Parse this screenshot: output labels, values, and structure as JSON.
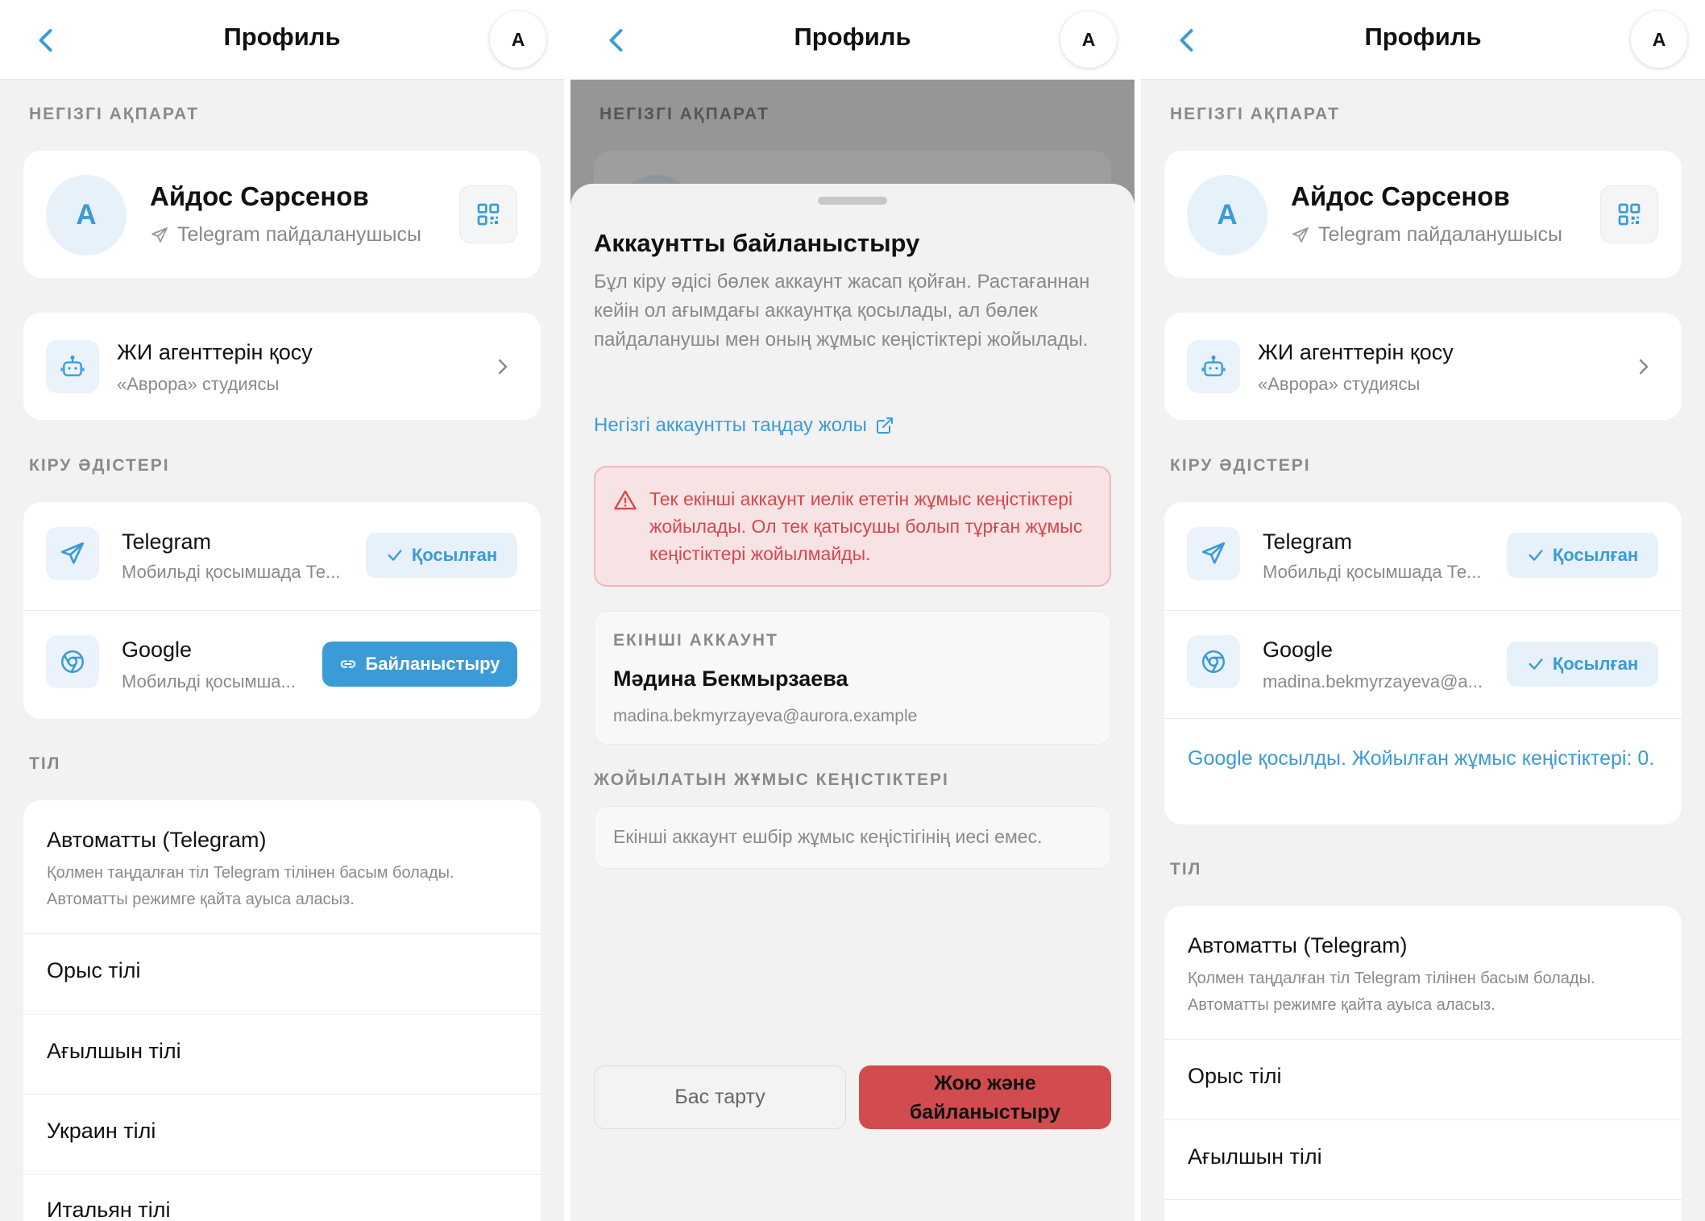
{
  "header": {
    "title": "Профиль",
    "avatar_letter": "A"
  },
  "sections": {
    "basic_info": "НЕГІЗГІ АҚПАРАТ",
    "login_methods": "КІРУ ӘДІСТЕРІ",
    "language": "ТІЛ"
  },
  "profile": {
    "avatar_letter": "A",
    "name": "Айдос Сәрсенов",
    "subtitle": "Telegram пайдаланушысы"
  },
  "ai_agents": {
    "title": "ЖИ агенттерін қосу",
    "subtitle": "«Аврора» студиясы"
  },
  "methods": {
    "telegram": {
      "title": "Telegram",
      "subtitle": "Мобильді қосымшада Те...",
      "status": "Қосылған"
    },
    "google": {
      "title": "Google",
      "subtitle": "Мобильді қосымша...",
      "action": "Байланыстыру"
    },
    "google_after": {
      "subtitle": "madina.bekmyrzayeva@a...",
      "status": "Қосылған"
    },
    "notice": "Google қосылды. Жойылған жұмыс кеңістіктері: 0."
  },
  "languages": {
    "auto_title": "Автоматты (Telegram)",
    "auto_desc": "Қолмен таңдалған тіл Telegram тілінен басым болады. Автоматты режимге қайта ауыса аласыз.",
    "items": [
      "Орыс тілі",
      "Ағылшын тілі",
      "Украин тілі",
      "Итальян тілі"
    ]
  },
  "sheet": {
    "title": "Аккаунтты байланыстыру",
    "description": "Бұл кіру әдісі бөлек аккаунт жасап қойған. Растағаннан кейін ол ағымдағы аккаунтқа қосылады, ал бөлек пайдаланушы мен оның жұмыс кеңістіктері жойылады.",
    "link": "Негізгі аккаунтты таңдау жолы",
    "warning": "Тек екінші аккаунт иелік ететін жұмыс кеңістіктері жойылады. Ол тек қатысушы болып тұрған жұмыс кеңістіктері жойылмайды.",
    "second_account_label": "ЕКІНШІ АККАУНТ",
    "second_account_name": "Мәдина Бекмырзаева",
    "second_account_email": "madina.bekmyrzayeva@aurora.example",
    "workspaces_label": "ЖОЙЫЛАТЫН ЖҰМЫС КЕҢІСТІКТЕРІ",
    "workspaces_empty": "Екінші аккаунт ешбір жұмыс кеңістігінің иесі емес.",
    "cancel": "Бас тарту",
    "confirm": "Жою және байланыстыру"
  },
  "colors": {
    "accent": "#3b9bd6",
    "danger": "#d24b4e",
    "background": "#f2f2f2"
  }
}
